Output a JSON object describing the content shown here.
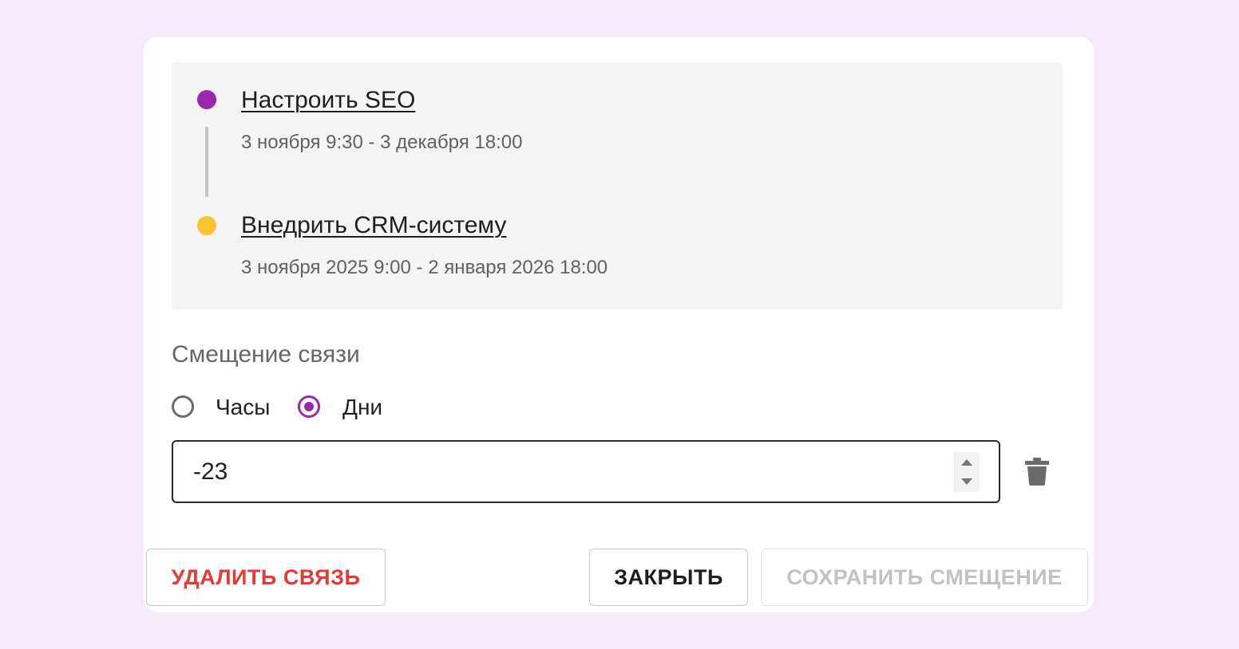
{
  "colors": {
    "page_background": "#f5eafc",
    "accent": "#9c27b0",
    "first_task_dot": "#9c27b0",
    "second_task_dot": "#fcc52a",
    "danger": "#e53935",
    "disabled_text": "#c2c2c2"
  },
  "link": {
    "predecessor": {
      "title": "Настроить SEO",
      "dates": "3 ноября 9:30 - 3 декабря 18:00"
    },
    "successor": {
      "title": "Внедрить CRM-систему",
      "dates": "3 ноября 2025 9:00 - 2 января 2026 18:00"
    }
  },
  "offset": {
    "section_label": "Смещение связи",
    "units": {
      "hours_label": "Часы",
      "days_label": "Дни",
      "selected": "days"
    },
    "value": "-23",
    "delete_icon": "trash-icon"
  },
  "footer": {
    "delete_link_label": "УДАЛИТЬ СВЯЗЬ",
    "close_label": "ЗАКРЫТЬ",
    "save_offset_label": "СОХРАНИТЬ СМЕЩЕНИЕ",
    "save_offset_enabled": false
  }
}
